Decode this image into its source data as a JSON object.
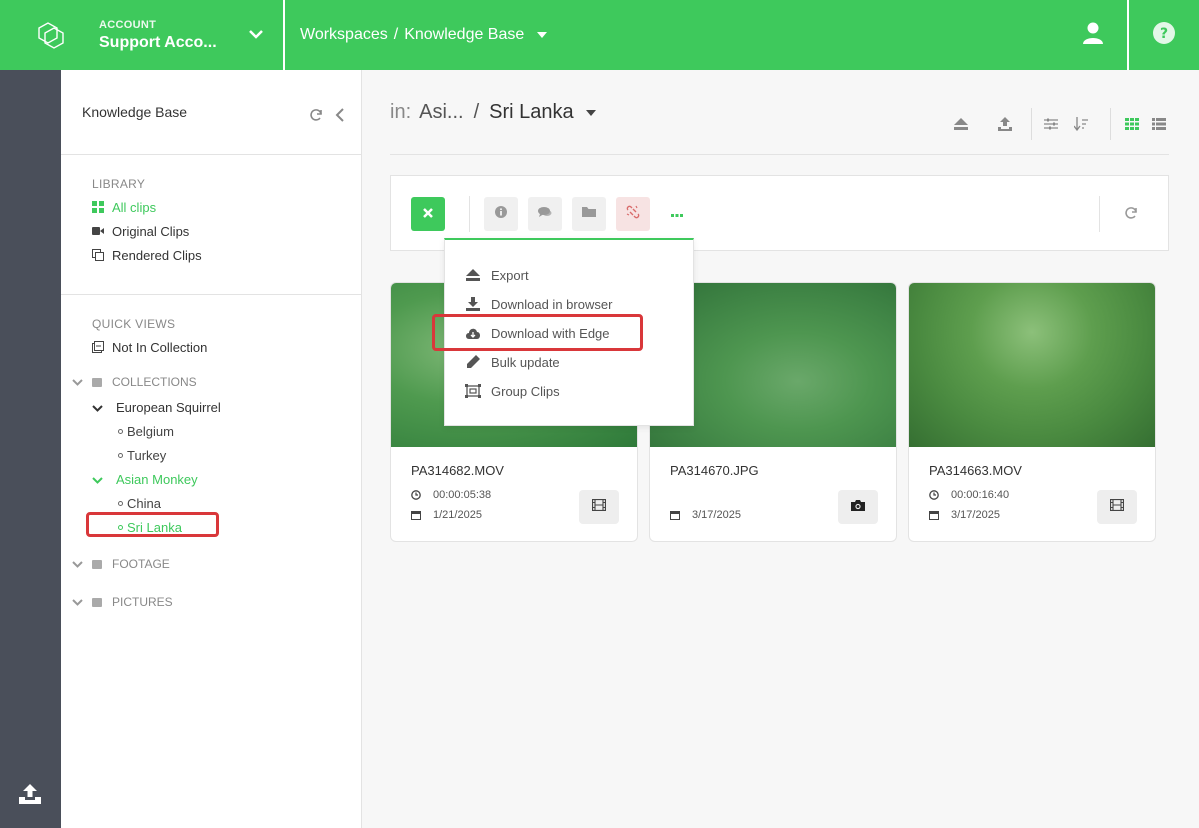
{
  "topbar": {
    "account_label": "ACCOUNT",
    "account_name": "Support Acco...",
    "breadcrumb_root": "Workspaces",
    "breadcrumb_sep": "/",
    "breadcrumb_current": "Knowledge Base"
  },
  "sidebar": {
    "title": "Knowledge Base",
    "library_title": "LIBRARY",
    "library_items": [
      "All clips",
      "Original Clips",
      "Rendered Clips"
    ],
    "quick_views_title": "QUICK VIEWS",
    "quick_views": [
      "Not In Collection"
    ],
    "collections_title": "COLLECTIONS",
    "collections": {
      "group1": "European Squirrel",
      "group1_children": [
        "Belgium",
        "Turkey"
      ],
      "group2": "Asian Monkey",
      "group2_children": [
        "China",
        "Sri Lanka"
      ]
    },
    "footage_title": "FOOTAGE",
    "pictures_title": "PICTURES"
  },
  "main": {
    "in_label": "in:",
    "parent": "Asi...",
    "slash": "/",
    "current": "Sri Lanka"
  },
  "menu": {
    "items": [
      "Export",
      "Download in browser",
      "Download with Edge",
      "Bulk update",
      "Group Clips"
    ]
  },
  "cards": [
    {
      "title": "PA314682.MOV",
      "duration": "00:00:05:38",
      "date": "1/21/2025",
      "type": "video"
    },
    {
      "title": "PA314670.JPG",
      "duration": "",
      "date": "3/17/2025",
      "type": "photo"
    },
    {
      "title": "PA314663.MOV",
      "duration": "00:00:16:40",
      "date": "3/17/2025",
      "type": "video"
    }
  ],
  "colors": {
    "accent": "#3ec95c",
    "rail": "#4a4f5a",
    "highlight": "#d9373a"
  }
}
